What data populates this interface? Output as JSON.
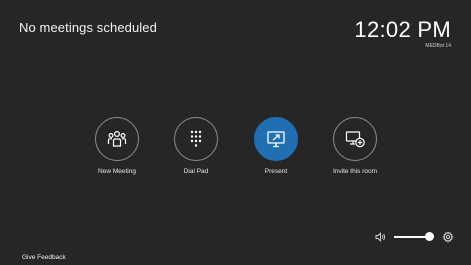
{
  "status": {
    "message": "No meetings scheduled"
  },
  "clock": {
    "time": "12:02 PM",
    "room": "MEDBot 14"
  },
  "actions": [
    {
      "label": "New Meeting",
      "icon": "people-group-icon",
      "active": false
    },
    {
      "label": "Dial Pad",
      "icon": "dialpad-icon",
      "active": false
    },
    {
      "label": "Present",
      "icon": "present-screen-icon",
      "active": true
    },
    {
      "label": "Invite this room",
      "icon": "invite-room-icon",
      "active": false
    }
  ],
  "footer": {
    "feedback_label": "Give Feedback"
  },
  "volume": {
    "level_fraction": 0.95
  },
  "colors": {
    "background": "#262626",
    "accent": "#1f6fb2"
  }
}
